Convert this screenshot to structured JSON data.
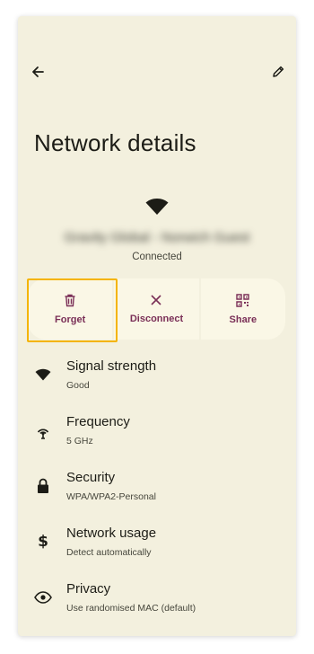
{
  "header": {
    "title": "Network details"
  },
  "network": {
    "name": "Gravity Global - Norwich Guest",
    "status": "Connected"
  },
  "actions": [
    {
      "label": "Forget",
      "icon": "trash-icon"
    },
    {
      "label": "Disconnect",
      "icon": "close-icon"
    },
    {
      "label": "Share",
      "icon": "qr-code-icon"
    }
  ],
  "details": [
    {
      "title": "Signal strength",
      "value": "Good",
      "icon": "wifi-icon"
    },
    {
      "title": "Frequency",
      "value": "5 GHz",
      "icon": "antenna-icon"
    },
    {
      "title": "Security",
      "value": "WPA/WPA2-Personal",
      "icon": "lock-icon"
    },
    {
      "title": "Network usage",
      "value": "Detect automatically",
      "icon": "dollar-icon"
    },
    {
      "title": "Privacy",
      "value": "Use randomised MAC (default)",
      "icon": "eye-icon"
    }
  ],
  "colors": {
    "background": "#f3f0de",
    "accent": "#7a2f57",
    "highlight": "#f4b400",
    "panel": "#faf7e6"
  }
}
